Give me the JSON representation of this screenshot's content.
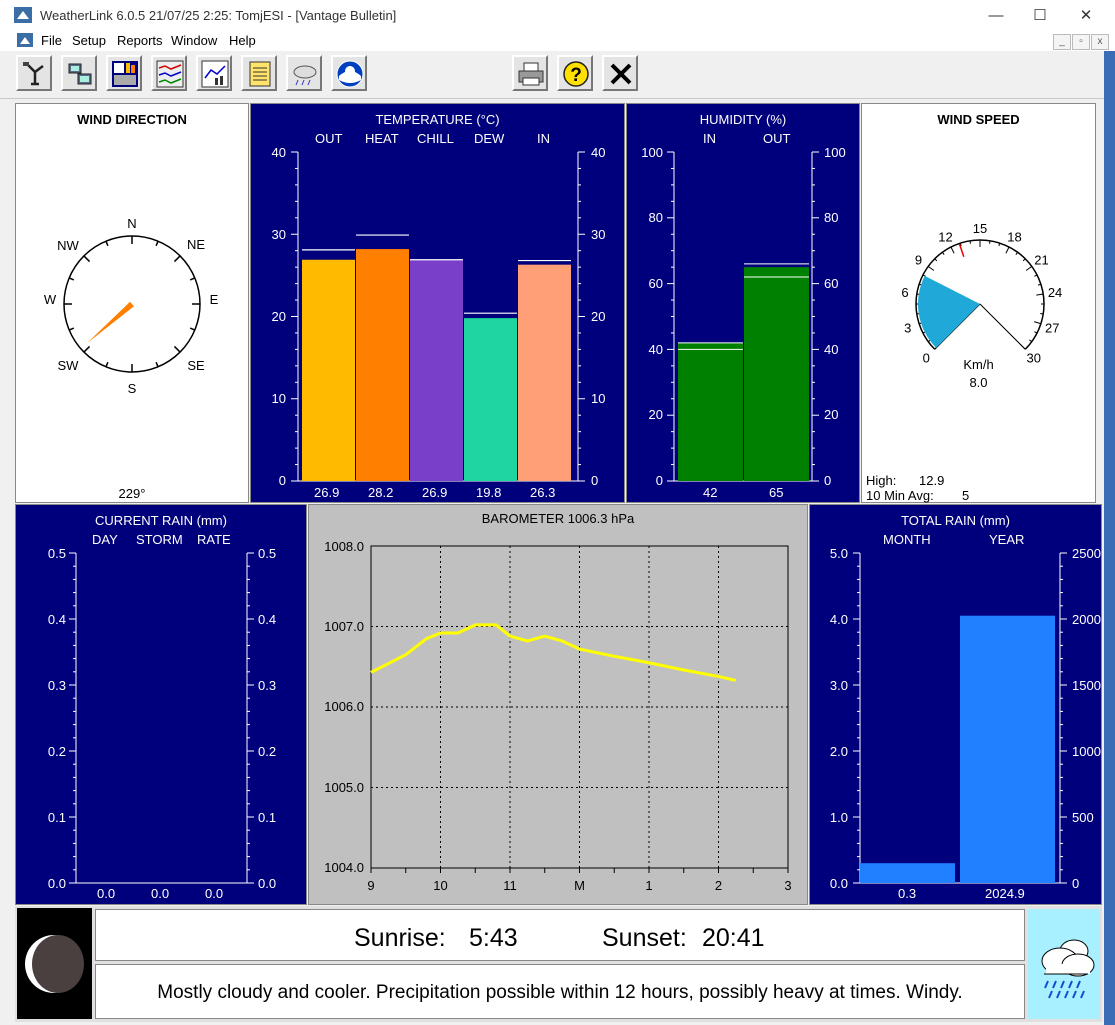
{
  "window": {
    "title": "WeatherLink 6.0.5  21/07/25   2:25: TomjESI - [Vantage Bulletin]",
    "controls": {
      "minimize": "—",
      "maximize": "☐",
      "close": "✕"
    }
  },
  "menu": {
    "items": [
      "File",
      "Setup",
      "Reports",
      "Window",
      "Help"
    ],
    "mdi_controls": {
      "minimize": "_",
      "restore": "▫",
      "close": "x"
    }
  },
  "toolbar": {
    "buttons": [
      "station-icon",
      "download-icon",
      "bulletin-icon",
      "strip-charts-icon",
      "plot-icon",
      "summary-icon",
      "forecast-cloud-icon",
      "noaa-icon",
      "print-icon",
      "help-icon",
      "exit-icon"
    ]
  },
  "wind_direction": {
    "title": "WIND DIRECTION",
    "labels": {
      "N": "N",
      "NE": "NE",
      "E": "E",
      "SE": "SE",
      "S": "S",
      "SW": "SW",
      "W": "W",
      "NW": "NW"
    },
    "value": "229°",
    "degrees": 229
  },
  "temperature": {
    "title": "TEMPERATURE  (°C)",
    "categories": [
      "OUT",
      "HEAT",
      "CHILL",
      "DEW",
      "IN"
    ],
    "values_text": [
      "26.9",
      "28.2",
      "26.9",
      "19.8",
      "26.3"
    ],
    "axis_ticks": [
      "40",
      "30",
      "20",
      "10",
      "0"
    ]
  },
  "humidity": {
    "title": "HUMIDITY  (%)",
    "categories": [
      "IN",
      "OUT"
    ],
    "values_text": [
      "42",
      "65"
    ],
    "axis_ticks": [
      "100",
      "80",
      "60",
      "40",
      "20",
      "0"
    ]
  },
  "wind_speed": {
    "title": "WIND SPEED",
    "dial_labels": [
      "0",
      "3",
      "6",
      "9",
      "12",
      "15",
      "18",
      "21",
      "24",
      "27",
      "30"
    ],
    "unit": "Km/h",
    "value": "8.0",
    "high_label": "High:",
    "high_value": "12.9",
    "avg_label": "10 Min Avg:",
    "avg_value": "5"
  },
  "current_rain": {
    "title": "CURRENT RAIN  (mm)",
    "categories": [
      "DAY",
      "STORM",
      "RATE"
    ],
    "values_text": [
      "0.0",
      "0.0",
      "0.0"
    ],
    "axis_ticks": [
      "0.5",
      "0.4",
      "0.3",
      "0.2",
      "0.1",
      "0.0"
    ]
  },
  "barometer": {
    "title": "BAROMETER 1006.3 hPa",
    "y_ticks": [
      "1008.0",
      "1007.0",
      "1006.0",
      "1005.0",
      "1004.0"
    ],
    "x_ticks": [
      "9",
      "10",
      "11",
      "M",
      "1",
      "2",
      "3"
    ]
  },
  "total_rain": {
    "title": "TOTAL RAIN  (mm)",
    "categories": [
      "MONTH",
      "YEAR"
    ],
    "values_text": [
      "0.3",
      "2024.9"
    ],
    "left_ticks": [
      "5.0",
      "4.0",
      "3.0",
      "2.0",
      "1.0",
      "0.0"
    ],
    "right_ticks": [
      "2500",
      "2000",
      "1500",
      "1000",
      "500",
      "0"
    ]
  },
  "bottom": {
    "sunrise_label": "Sunrise:",
    "sunrise_time": "5:43",
    "sunset_label": "Sunset:",
    "sunset_time": "20:41",
    "forecast": "Mostly cloudy and cooler.  Precipitation possible within 12 hours, possibly heavy at times.  Windy.",
    "moon_icon": "moon-phase-icon",
    "forecast_icon": "cloud-rain-icon"
  },
  "colors": {
    "panel_navy": "#00007c",
    "temp_out": "#ffbb00",
    "temp_heat": "#ff7f00",
    "temp_chill": "#7a3fc8",
    "temp_dew": "#1fd6a0",
    "temp_in": "#ff9f78",
    "humidity_bar": "#008000",
    "rain_bar": "#2080ff",
    "baro_line": "#ffff00",
    "wind_wedge": "#1fa8d8",
    "wind_arrow": "#ff7f00"
  },
  "chart_data": [
    {
      "type": "bar",
      "title": "TEMPERATURE  (°C)",
      "categories": [
        "OUT",
        "HEAT",
        "CHILL",
        "DEW",
        "IN"
      ],
      "values": [
        26.9,
        28.2,
        26.9,
        19.8,
        26.3
      ],
      "highs": [
        28.1,
        29.9,
        26.9,
        20.4,
        26.8
      ],
      "ylim": [
        0,
        40
      ]
    },
    {
      "type": "bar",
      "title": "HUMIDITY  (%)",
      "categories": [
        "IN",
        "OUT"
      ],
      "values": [
        42,
        65
      ],
      "highs": [
        42,
        66
      ],
      "lows": [
        40,
        62
      ],
      "ylim": [
        0,
        100
      ]
    },
    {
      "type": "bar",
      "title": "CURRENT RAIN  (mm)",
      "categories": [
        "DAY",
        "STORM",
        "RATE"
      ],
      "values": [
        0.0,
        0.0,
        0.0
      ],
      "ylim": [
        0,
        0.5
      ]
    },
    {
      "type": "line",
      "title": "BAROMETER 1006.3 hPa",
      "x_labels": [
        "9",
        "10",
        "11",
        "M",
        "1",
        "2",
        "3"
      ],
      "x": [
        9.0,
        9.5,
        9.8,
        10.0,
        10.25,
        10.5,
        10.8,
        11.0,
        11.25,
        11.5,
        11.75,
        12.0,
        12.5,
        13.0,
        13.5,
        14.0,
        14.25
      ],
      "y": [
        1006.43,
        1006.65,
        1006.85,
        1006.92,
        1006.92,
        1007.02,
        1007.02,
        1006.88,
        1006.82,
        1006.88,
        1006.82,
        1006.72,
        1006.63,
        1006.55,
        1006.46,
        1006.38,
        1006.33
      ],
      "ylim": [
        1004.0,
        1008.0
      ],
      "xlim": [
        9,
        15
      ],
      "grid": true
    },
    {
      "type": "bar",
      "title": "TOTAL RAIN  (mm)",
      "categories": [
        "MONTH",
        "YEAR"
      ],
      "values": [
        0.3,
        2024.9
      ],
      "ylim_month": [
        0,
        5.0
      ],
      "ylim_year": [
        0,
        2500
      ]
    }
  ]
}
